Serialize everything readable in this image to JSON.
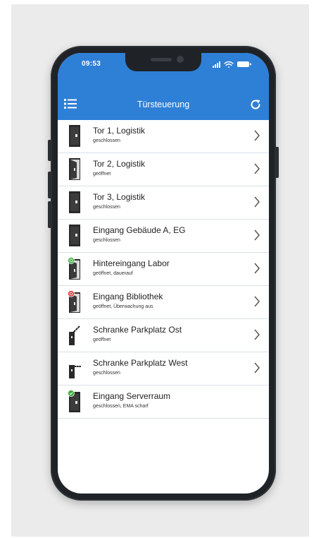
{
  "status_bar": {
    "time": "09:53"
  },
  "app_bar": {
    "title": "Türsteuerung",
    "menu_icon": "list-menu-icon",
    "refresh_icon": "refresh-icon"
  },
  "colors": {
    "appbar": "#2e7fd6",
    "divider": "#d9e1ea",
    "status_open_badge": "#3bab3b",
    "status_alarm_badge": "#d9322e"
  },
  "doors": [
    {
      "title": "Tor 1, Logistik",
      "status": "geschlossen",
      "icon": "door-closed-icon",
      "has_chevron": true
    },
    {
      "title": "Tor 2, Logistik",
      "status": "geöffnet",
      "icon": "door-open-icon",
      "has_chevron": true
    },
    {
      "title": "Tor 3, Logistik",
      "status": "geschlossen",
      "icon": "door-closed-icon",
      "has_chevron": true
    },
    {
      "title": "Eingang Gebäude A, EG",
      "status": "geschlossen",
      "icon": "door-closed-icon",
      "has_chevron": true
    },
    {
      "title": "Hintereingang Labor",
      "status": "geöffnet, dauerauf",
      "icon": "door-open-permanent-icon",
      "has_chevron": true
    },
    {
      "title": "Eingang Bibliothek",
      "status": "geöffnet, Überwachung aus",
      "icon": "door-open-alarm-off-icon",
      "has_chevron": true
    },
    {
      "title": "Schranke Parkplatz Ost",
      "status": "geöffnet",
      "icon": "barrier-open-icon",
      "has_chevron": true
    },
    {
      "title": "Schranke Parkplatz West",
      "status": "geschlossen",
      "icon": "barrier-closed-icon",
      "has_chevron": true
    },
    {
      "title": "Eingang Serverraum",
      "status": "geschlossen, EMA scharf",
      "icon": "door-closed-armed-icon",
      "has_chevron": false
    }
  ]
}
